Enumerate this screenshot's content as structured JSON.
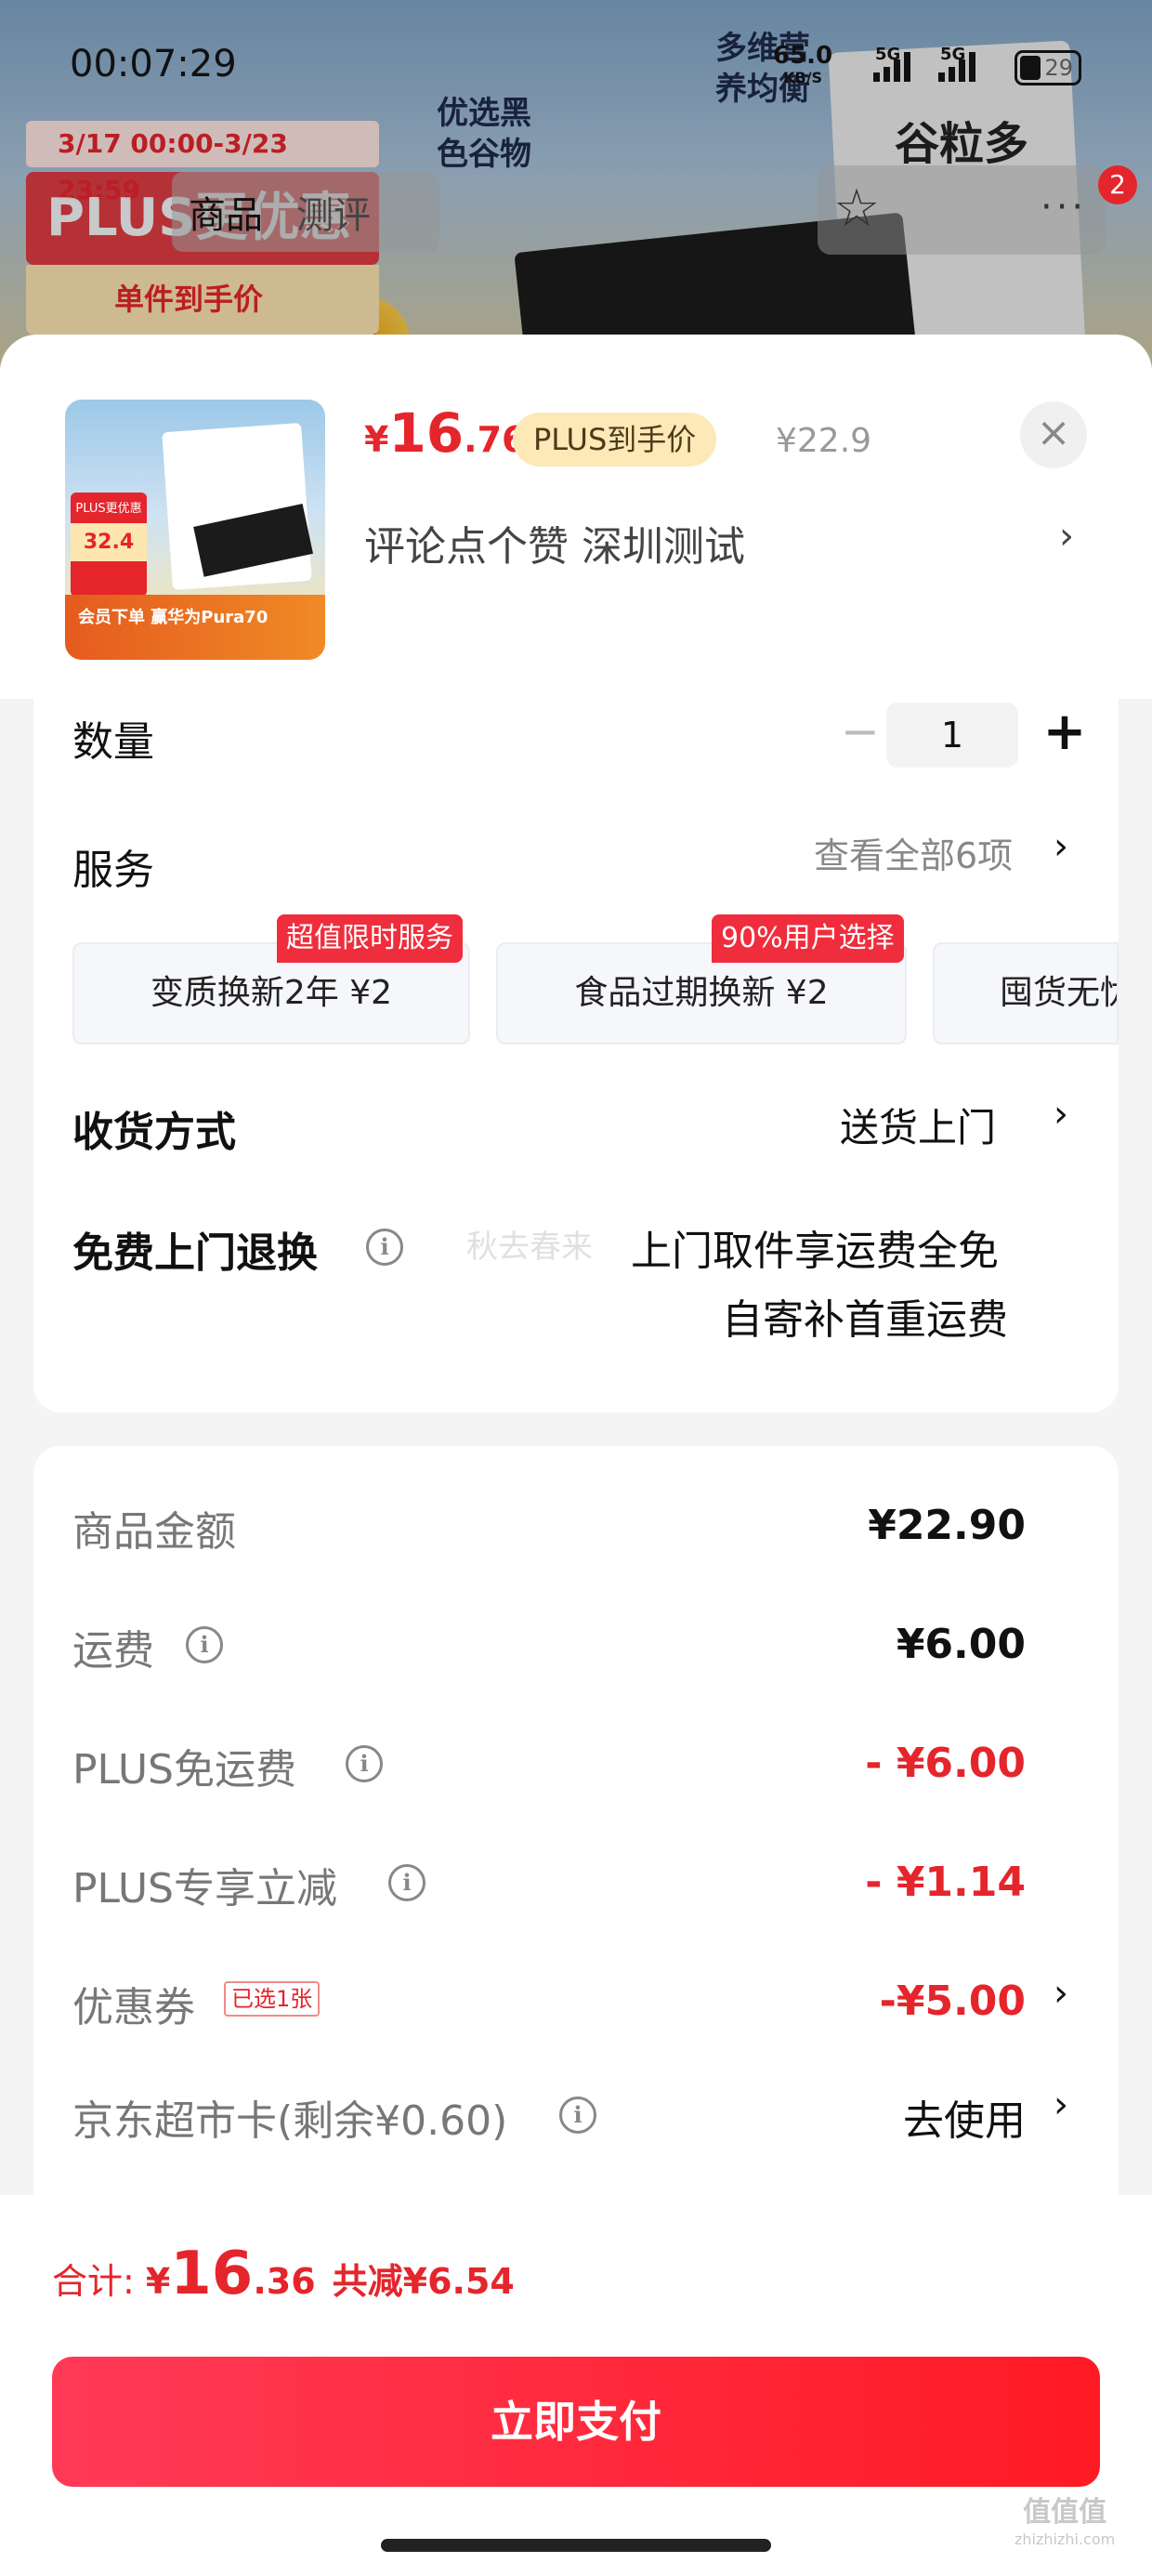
{
  "status_bar": {
    "time": "00:07:29",
    "net_speed": "65.0",
    "net_unit": "KB/S",
    "sim1": "5G",
    "sim2": "5G",
    "battery": "29"
  },
  "background": {
    "promo_date": "3/17 00:00-3/23 23:59",
    "promo_plus": "PLUS更优惠",
    "promo_unit": "单件到手价",
    "tag_black": "优选黑色谷物",
    "tag_vitamin": "多维营养均衡",
    "brand": "谷粒多",
    "tabs": [
      "商品",
      "测评"
    ],
    "cart_count": "2"
  },
  "product": {
    "thumb_badge": "PLUS更优惠",
    "thumb_price": "32.4",
    "thumb_footer": "会员下单 赢华为Pura70",
    "price_currency": "¥",
    "price_int": "16",
    "price_dec": ".76",
    "plus_tag": "PLUS到手价",
    "original_price": "¥22.9",
    "variant": "评论点个赞  深圳测试"
  },
  "options": {
    "quantity_label": "数量",
    "quantity_value": "1",
    "service_label": "服务",
    "service_all": "查看全部6项",
    "services": [
      {
        "name": "变质换新2年  ¥2",
        "badge": "超值限时服务"
      },
      {
        "name": "食品过期换新  ¥2",
        "badge": "90%用户选择"
      },
      {
        "name": "囤货无忧",
        "badge": ""
      }
    ],
    "delivery_label": "收货方式",
    "delivery_value": "送货上门",
    "return_label": "免费上门退换",
    "return_line1": "上门取件享运费全免",
    "return_line2": "自寄补首重运费",
    "watermark": "秋去春来"
  },
  "fees": {
    "goods_label": "商品金额",
    "goods_value": "¥22.90",
    "shipping_label": "运费",
    "shipping_value": "¥6.00",
    "plus_free_label": "PLUS免运费",
    "plus_free_value": "- ¥6.00",
    "plus_cut_label": "PLUS专享立减",
    "plus_cut_value": "- ¥1.14",
    "coupon_label": "优惠券",
    "coupon_tag": "已选1张",
    "coupon_value": "-¥5.00",
    "card_label": "京东超市卡(剩余¥0.60)",
    "card_value": "去使用"
  },
  "footer": {
    "total_label": "合计:",
    "total_currency": "¥",
    "total_int": "16",
    "total_dec": ".36",
    "total_saved": "共减¥6.54",
    "pay_button": "立即支付",
    "site_mark": "值值值",
    "site_url": "zhizhizhi.com"
  },
  "colors": {
    "accent_red": "#e5252c",
    "pay_gradient_start": "#ff3a57",
    "pay_gradient_end": "#ff1a24",
    "plus_tag_bg": "#fde9b8"
  }
}
